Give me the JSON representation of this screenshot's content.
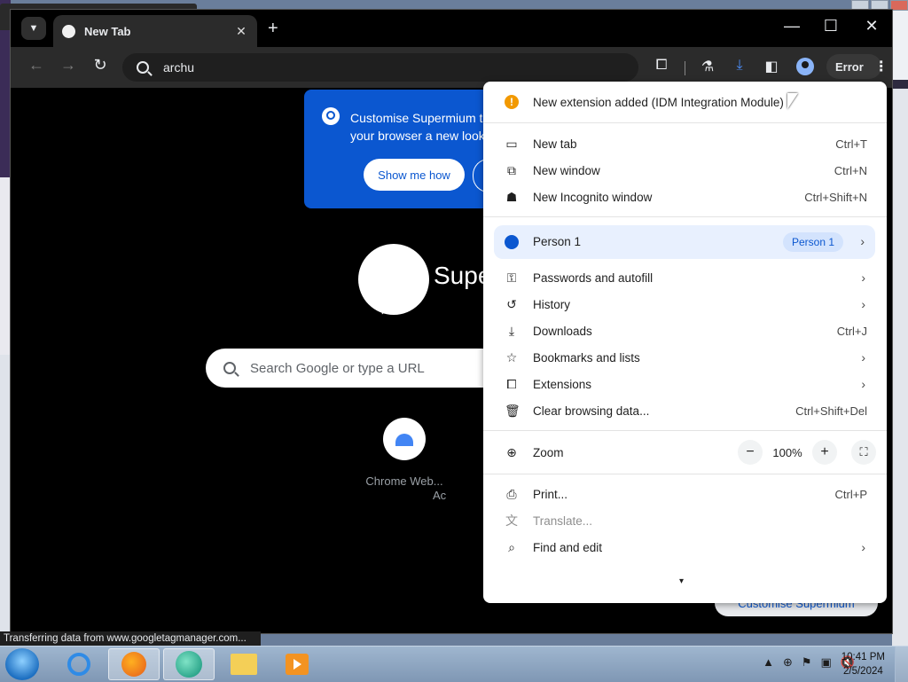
{
  "browser": {
    "tab": {
      "title": "New Tab",
      "close": "✕"
    },
    "new_tab_button": "+",
    "window_controls": {
      "minimize": "—",
      "maximize": "☐",
      "close": "✕"
    },
    "nav": {
      "back": "←",
      "forward": "→",
      "reload": "↻"
    },
    "omnibox_value": "archu",
    "toolbar_icons": [
      "extensions-icon",
      "labs-icon",
      "download-icon",
      "side-panel-icon",
      "profile-icon"
    ],
    "error_chip": "Error",
    "menu_dots": "⋮"
  },
  "ntp": {
    "promo_text": "Customise Supermium to give your browser a new look",
    "promo_button": "Show me how",
    "brand": "Supe",
    "search_placeholder": "Search Google or type a URL",
    "shortcuts": [
      {
        "label": "Chrome Web..."
      },
      {
        "label": "Ac"
      }
    ],
    "customise_chip": "Customise Supermium"
  },
  "menu": {
    "alert": "New extension added (IDM Integration Module)",
    "items_group1": [
      {
        "icon": "new-tab-icon",
        "glyph": "▭",
        "label": "New tab",
        "shortcut": "Ctrl+T"
      },
      {
        "icon": "new-window-icon",
        "glyph": "⧉",
        "label": "New window",
        "shortcut": "Ctrl+N"
      },
      {
        "icon": "incognito-icon",
        "glyph": "☗",
        "label": "New Incognito window",
        "shortcut": "Ctrl+Shift+N"
      }
    ],
    "person": {
      "label": "Person 1",
      "badge": "Person 1",
      "arrow": "›"
    },
    "items_group2": [
      {
        "icon": "key-icon",
        "glyph": "⚿",
        "label": "Passwords and autofill",
        "arrow": "›"
      },
      {
        "icon": "history-icon",
        "glyph": "↺",
        "label": "History",
        "arrow": "›"
      },
      {
        "icon": "download-icon",
        "glyph": "⤓",
        "label": "Downloads",
        "shortcut": "Ctrl+J"
      },
      {
        "icon": "star-icon",
        "glyph": "☆",
        "label": "Bookmarks and lists",
        "arrow": "›"
      },
      {
        "icon": "puzzle-icon",
        "glyph": "⧠",
        "label": "Extensions",
        "arrow": "›"
      },
      {
        "icon": "trash-icon",
        "glyph": "🗑",
        "label": "Clear browsing data...",
        "shortcut": "Ctrl+Shift+Del"
      }
    ],
    "zoom": {
      "label": "Zoom",
      "minus": "−",
      "value": "100%",
      "plus": "+",
      "fullscreen": "⛶"
    },
    "items_group3": [
      {
        "icon": "printer-icon",
        "glyph": "⎙",
        "label": "Print...",
        "shortcut": "Ctrl+P"
      },
      {
        "icon": "translate-icon",
        "glyph": "文",
        "label": "Translate..."
      },
      {
        "icon": "find-icon",
        "glyph": "⌕",
        "label": "Find and edit",
        "arrow": "›"
      }
    ],
    "more_arrow": "▾"
  },
  "status_bar": "Transferring data from www.googletagmanager.com...",
  "taskbar": {
    "tray_glyphs": [
      "▲",
      "⊕",
      "⚑",
      "▣",
      "🔇"
    ],
    "time": "10:41 PM",
    "date": "2/5/2024"
  }
}
